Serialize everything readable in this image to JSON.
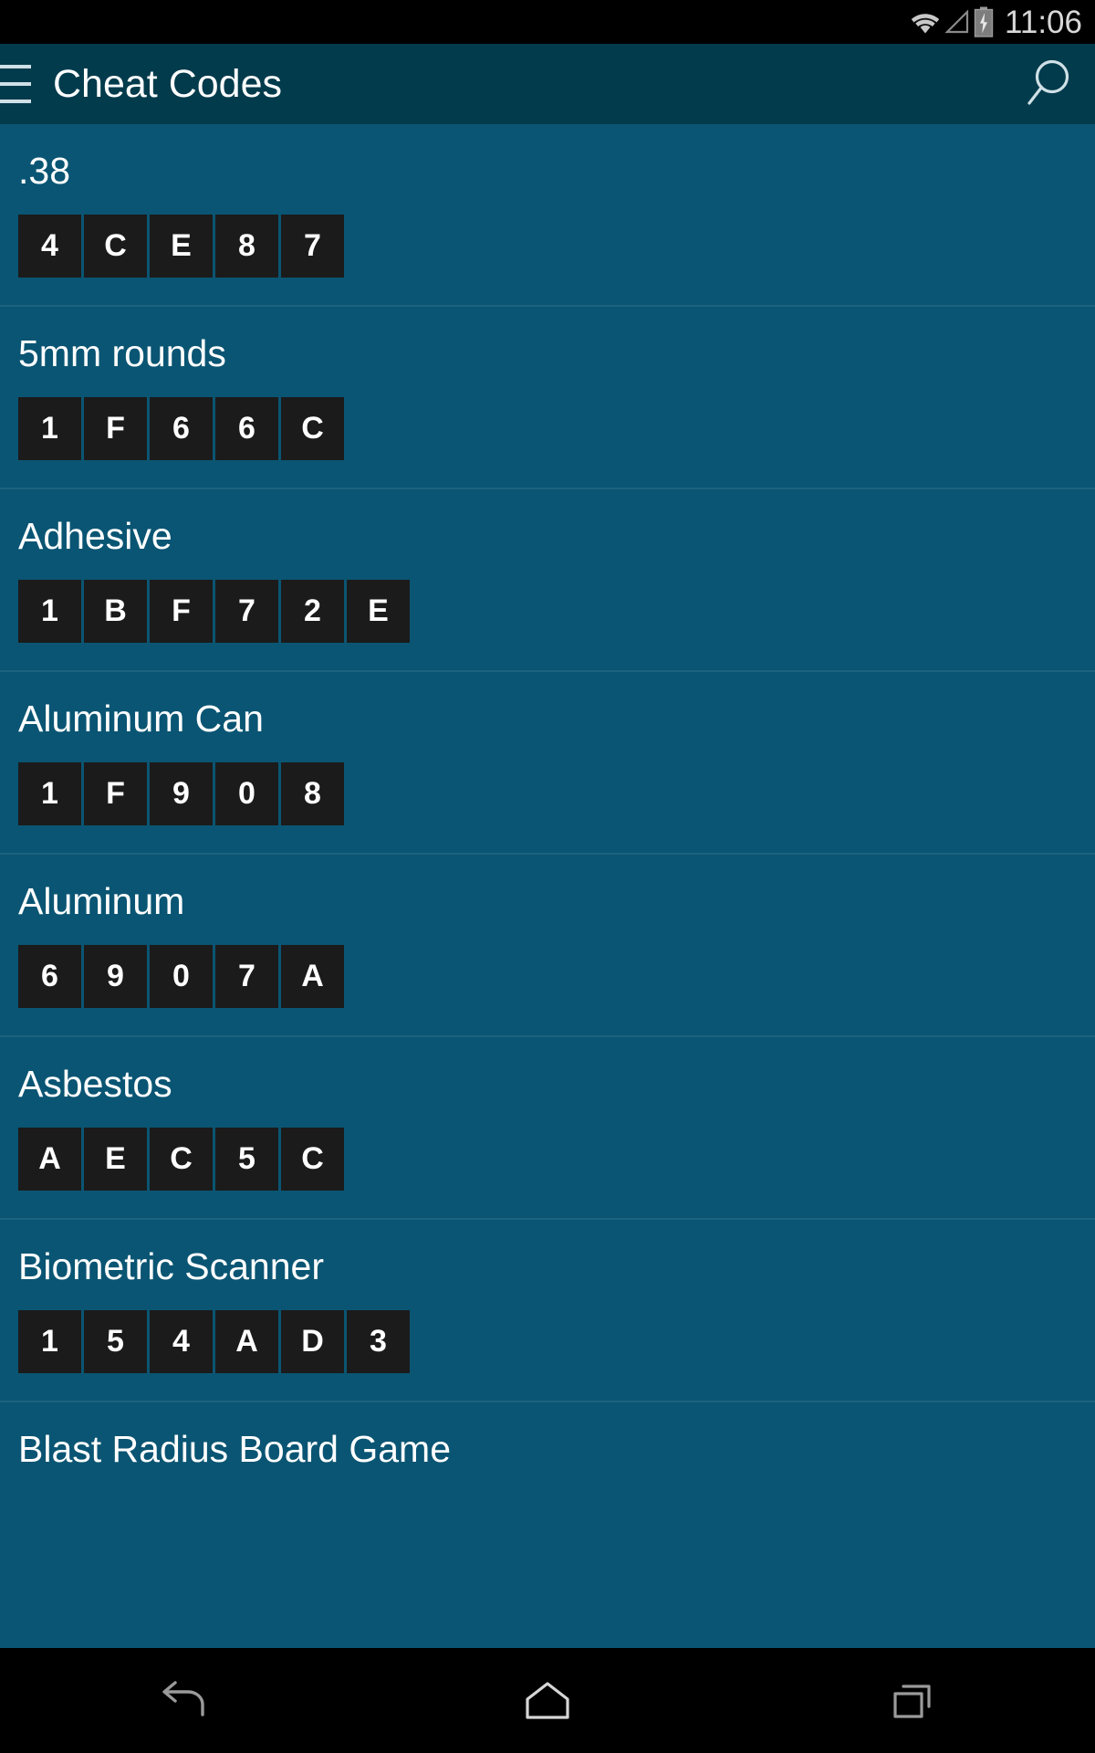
{
  "status_bar": {
    "clock": "11:06",
    "icons": [
      "wifi-icon",
      "cell-signal-icon",
      "battery-charging-icon"
    ]
  },
  "app_bar": {
    "title": "Cheat Codes",
    "menu_icon": "hamburger-menu-icon",
    "search_icon": "search-icon"
  },
  "colors": {
    "status_bar_bg": "#000000",
    "app_bar_bg": "#023b4c",
    "list_bg": "#0a5573",
    "tile_bg": "#1b1b1b",
    "tile_text": "#ffffff",
    "divider": "#1c637f",
    "nav_bar_bg": "#000000"
  },
  "list": {
    "items": [
      {
        "name": ".38",
        "code": [
          "4",
          "C",
          "E",
          "8",
          "7"
        ]
      },
      {
        "name": "5mm rounds",
        "code": [
          "1",
          "F",
          "6",
          "6",
          "C"
        ]
      },
      {
        "name": "Adhesive",
        "code": [
          "1",
          "B",
          "F",
          "7",
          "2",
          "E"
        ]
      },
      {
        "name": "Aluminum Can",
        "code": [
          "1",
          "F",
          "9",
          "0",
          "8"
        ]
      },
      {
        "name": "Aluminum",
        "code": [
          "6",
          "9",
          "0",
          "7",
          "A"
        ]
      },
      {
        "name": "Asbestos",
        "code": [
          "A",
          "E",
          "C",
          "5",
          "C"
        ]
      },
      {
        "name": "Biometric Scanner",
        "code": [
          "1",
          "5",
          "4",
          "A",
          "D",
          "3"
        ]
      },
      {
        "name": "Blast Radius Board Game",
        "code": []
      }
    ]
  },
  "nav_bar": {
    "buttons": [
      {
        "name": "back-button",
        "icon": "back-arrow-icon"
      },
      {
        "name": "home-button",
        "icon": "home-icon"
      },
      {
        "name": "recents-button",
        "icon": "recents-icon"
      }
    ]
  }
}
